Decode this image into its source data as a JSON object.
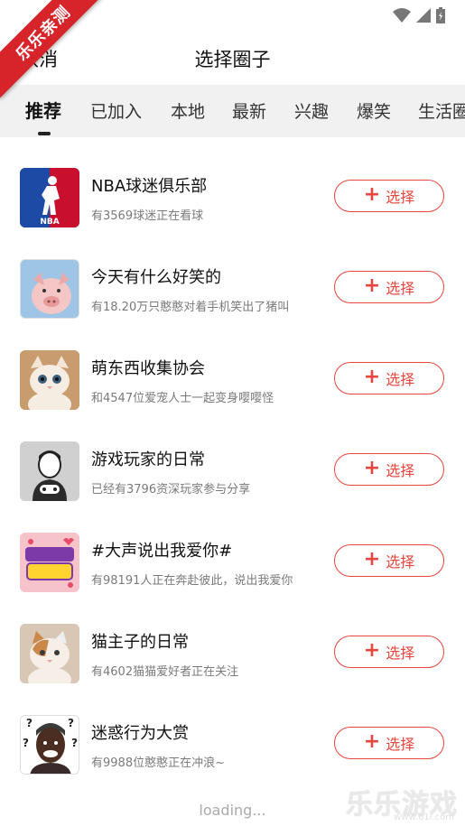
{
  "ribbon": "乐乐亲测",
  "header": {
    "cancel": "取消",
    "title": "选择圈子"
  },
  "tabs": [
    "推荐",
    "已加入",
    "本地",
    "最新",
    "兴趣",
    "爆笑",
    "生活圈"
  ],
  "list": [
    {
      "name": "NBA球迷俱乐部",
      "desc": "有3569球迷正在看球",
      "icon": "nba-logo-icon"
    },
    {
      "name": "今天有什么好笑的",
      "desc": "有18.20万只憨憨对着手机笑出了猪叫",
      "icon": "pig-photo-icon"
    },
    {
      "name": "萌东西收集协会",
      "desc": "和4547位爱宠人士一起变身嘤嘤怪",
      "icon": "kitten-photo-icon"
    },
    {
      "name": "游戏玩家的日常",
      "desc": "已经有3796资深玩家参与分享",
      "icon": "gamer-icon"
    },
    {
      "name": "#大声说出我爱你#",
      "desc": "有98191人正在奔赴彼此，说出我爱你",
      "icon": "love-poster-icon"
    },
    {
      "name": "猫主子的日常",
      "desc": "有4602猫猫爱好者正在关注",
      "icon": "cat-photo-icon"
    },
    {
      "name": "迷惑行为大赏",
      "desc": "有9988位憨憨正在冲浪~",
      "icon": "confused-man-icon"
    }
  ],
  "button_label": "选择",
  "loading": "loading...",
  "watermark": {
    "text": "乐乐游戏",
    "url": "www.61l.com"
  }
}
